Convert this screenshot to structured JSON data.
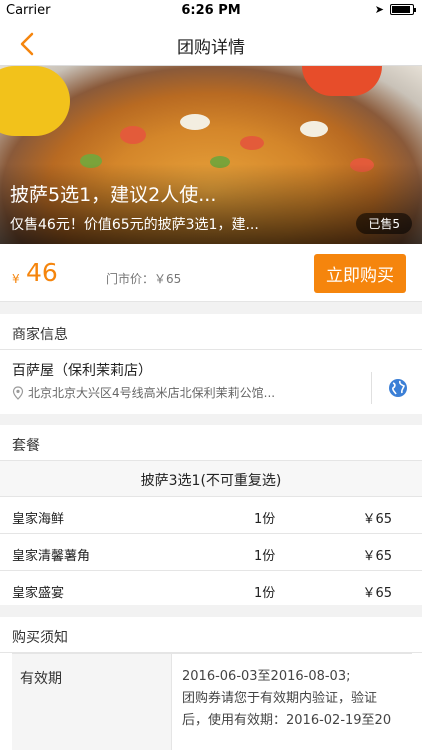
{
  "status": {
    "carrier": "Carrier",
    "time": "6:26 PM"
  },
  "nav": {
    "title": "团购详情"
  },
  "hero": {
    "title": "披萨5选1，建议2人使...",
    "subtitle": "仅售46元！价值65元的披萨3选1，建...",
    "sold": "已售5"
  },
  "price": {
    "currency": "¥",
    "value": "46",
    "market": "门市价：￥65",
    "buy_label": "立即购买"
  },
  "merchant": {
    "header": "商家信息",
    "name": "百萨屋（保利茉莉店）",
    "address": "北京北京大兴区4号线高米店北保利茉莉公馆..."
  },
  "package": {
    "header": "套餐",
    "title": "披萨3选1(不可重复选)",
    "items": [
      {
        "name": "皇家海鲜",
        "qty": "1份",
        "price": "￥65"
      },
      {
        "name": "皇家清馨薯角",
        "qty": "1份",
        "price": "￥65"
      },
      {
        "name": "皇家盛宴",
        "qty": "1份",
        "price": "￥65"
      }
    ]
  },
  "notice": {
    "header": "购买须知",
    "label": "有效期",
    "lines": [
      "2016-06-03至2016-08-03;",
      "团购券请您于有效期内验证，验证",
      "后，使用有效期：2016-02-19至20"
    ]
  },
  "colors": {
    "accent": "#f5850d"
  }
}
